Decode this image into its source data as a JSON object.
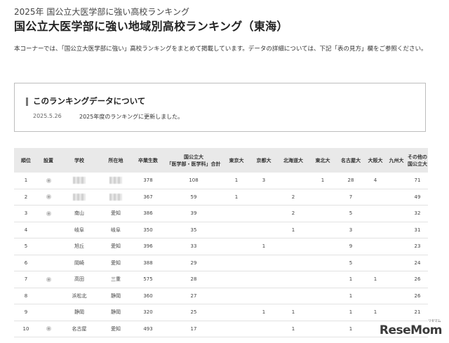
{
  "header": {
    "kicker": "2025年 国公立大医学部に強い高校ランキング",
    "title": "国公立大医学部に強い地域別高校ランキング（東海）",
    "intro": "本コーナーでは、「国公立大医学部に強い」高校ランキングをまとめて掲載しています。データの詳細については、下記「表の見方」欄をご参照ください。"
  },
  "info": {
    "heading": "このランキングデータについて",
    "date": "2025.5.26",
    "note": "2025年度のランキングに更新しました。"
  },
  "table": {
    "headers": {
      "rank": "順位",
      "setup": "設置",
      "school": "学校",
      "location": "所在地",
      "graduates": "卒業生数",
      "total_l1": "国公立大",
      "total_l2": "「医学部・医学科」合計",
      "tokyo": "東京大",
      "kyoto": "京都大",
      "hokkaido": "北海道大",
      "tohoku": "東北大",
      "nagoya": "名古屋大",
      "osaka": "大阪大",
      "kyushu": "九州大",
      "other_l1": "その他の",
      "other_l2": "国公立大"
    },
    "rows": [
      {
        "rank": "1",
        "flag": true,
        "school": "",
        "location": "",
        "graduates": "378",
        "total": "108",
        "tokyo": "1",
        "kyoto": "3",
        "hokkaido": "",
        "tohoku": "1",
        "nagoya": "28",
        "osaka": "4",
        "kyushu": "",
        "other": "71",
        "blurred": true
      },
      {
        "rank": "2",
        "flag": true,
        "school": "",
        "location": "",
        "graduates": "367",
        "total": "59",
        "tokyo": "1",
        "kyoto": "",
        "hokkaido": "2",
        "tohoku": "",
        "nagoya": "7",
        "osaka": "",
        "kyushu": "",
        "other": "49",
        "blurred": true
      },
      {
        "rank": "3",
        "flag": true,
        "school": "南山",
        "location": "愛知",
        "graduates": "386",
        "total": "39",
        "tokyo": "",
        "kyoto": "",
        "hokkaido": "2",
        "tohoku": "",
        "nagoya": "5",
        "osaka": "",
        "kyushu": "",
        "other": "32",
        "blurred": false
      },
      {
        "rank": "4",
        "flag": false,
        "school": "岐阜",
        "location": "岐阜",
        "graduates": "350",
        "total": "35",
        "tokyo": "",
        "kyoto": "",
        "hokkaido": "1",
        "tohoku": "",
        "nagoya": "3",
        "osaka": "",
        "kyushu": "",
        "other": "31",
        "blurred": false
      },
      {
        "rank": "5",
        "flag": false,
        "school": "旭丘",
        "location": "愛知",
        "graduates": "396",
        "total": "33",
        "tokyo": "",
        "kyoto": "1",
        "hokkaido": "",
        "tohoku": "",
        "nagoya": "9",
        "osaka": "",
        "kyushu": "",
        "other": "23",
        "blurred": false
      },
      {
        "rank": "6",
        "flag": false,
        "school": "岡崎",
        "location": "愛知",
        "graduates": "388",
        "total": "29",
        "tokyo": "",
        "kyoto": "",
        "hokkaido": "",
        "tohoku": "",
        "nagoya": "5",
        "osaka": "",
        "kyushu": "",
        "other": "24",
        "blurred": false
      },
      {
        "rank": "7",
        "flag": true,
        "school": "高田",
        "location": "三重",
        "graduates": "575",
        "total": "28",
        "tokyo": "",
        "kyoto": "",
        "hokkaido": "",
        "tohoku": "",
        "nagoya": "1",
        "osaka": "1",
        "kyushu": "",
        "other": "26",
        "blurred": false
      },
      {
        "rank": "8",
        "flag": false,
        "school": "浜松北",
        "location": "静岡",
        "graduates": "360",
        "total": "27",
        "tokyo": "",
        "kyoto": "",
        "hokkaido": "",
        "tohoku": "",
        "nagoya": "1",
        "osaka": "",
        "kyushu": "",
        "other": "26",
        "blurred": false
      },
      {
        "rank": "9",
        "flag": false,
        "school": "静岡",
        "location": "静岡",
        "graduates": "320",
        "total": "25",
        "tokyo": "",
        "kyoto": "1",
        "hokkaido": "1",
        "tohoku": "",
        "nagoya": "1",
        "osaka": "1",
        "kyushu": "",
        "other": "21",
        "blurred": false
      },
      {
        "rank": "10",
        "flag": true,
        "school": "名古屋",
        "location": "愛知",
        "graduates": "493",
        "total": "17",
        "tokyo": "",
        "kyoto": "",
        "hokkaido": "1",
        "tohoku": "",
        "nagoya": "1",
        "osaka": "",
        "kyushu": "",
        "other": "",
        "blurred": false
      }
    ]
  },
  "logo": {
    "text": "ReseMom",
    "sub": "リセマム"
  }
}
